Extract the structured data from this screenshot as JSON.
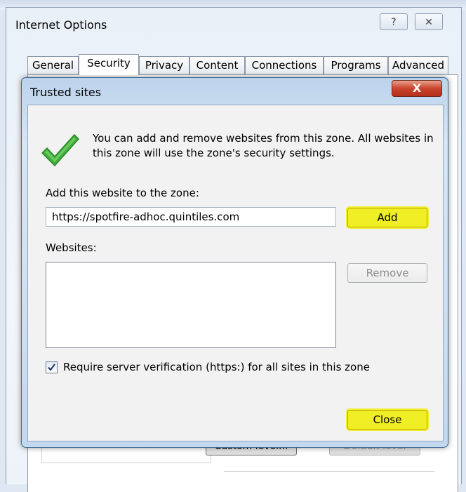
{
  "outer_window": {
    "title": "Internet Options",
    "help_label": "?",
    "close_label": "✕",
    "tabs": [
      "General",
      "Security",
      "Privacy",
      "Content",
      "Connections",
      "Programs",
      "Advanced"
    ],
    "active_tab": "Security",
    "bottom_buttons": {
      "custom_level": "Custom level...",
      "default_level": "Default level"
    }
  },
  "dialog": {
    "title": "Trusted sites",
    "close_label": "X",
    "intro_text": "You can add and remove websites from this zone. All websites in this zone will use the zone's security settings.",
    "add_label": "Add this website to the zone:",
    "url_value": "https://spotfire-adhoc.quintiles.com",
    "add_button": "Add",
    "websites_label": "Websites:",
    "websites": [],
    "remove_button": "Remove",
    "require_verification_label": "Require server verification (https:) for all sites in this zone",
    "require_verification_checked": true,
    "close_button": "Close"
  },
  "colors": {
    "highlight": "#f0ee25",
    "dialog_close": "#c9452b",
    "checkmark": "#3fae3a"
  }
}
